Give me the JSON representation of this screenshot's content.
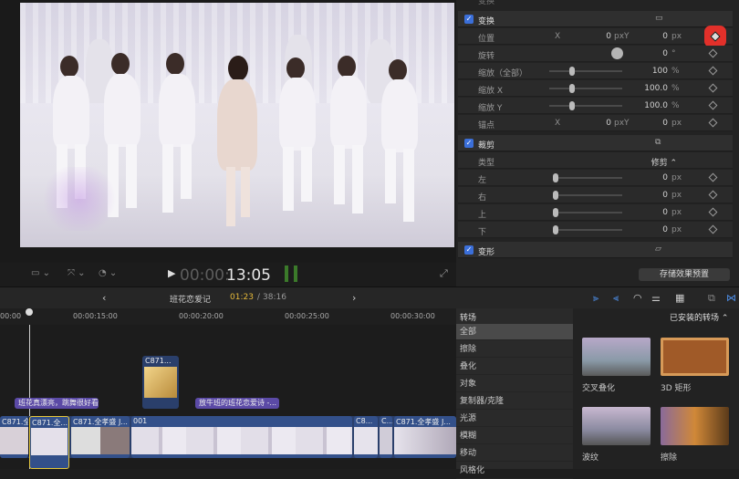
{
  "viewer": {
    "timecode_dim": "00:00:",
    "timecode": "13:05"
  },
  "inspector": {
    "top_label": "变换",
    "transform": {
      "title": "变换",
      "position": {
        "label": "位置",
        "x_label": "X",
        "x_value": "0",
        "x_unit": "px",
        "y_label": "Y",
        "y_value": "0",
        "y_unit": "px"
      },
      "rotation": {
        "label": "旋转",
        "value": "0",
        "unit": "°"
      },
      "scale_all": {
        "label": "缩放（全部）",
        "value": "100",
        "unit": "%"
      },
      "scale_x": {
        "label": "缩放 X",
        "value": "100.0",
        "unit": "%"
      },
      "scale_y": {
        "label": "缩放 Y",
        "value": "100.0",
        "unit": "%"
      },
      "anchor": {
        "label": "锚点",
        "x_label": "X",
        "x_value": "0",
        "x_unit": "px",
        "y_label": "Y",
        "y_value": "0",
        "y_unit": "px"
      }
    },
    "crop": {
      "title": "裁剪",
      "type": {
        "label": "类型",
        "value": "修剪 ⌃"
      },
      "left": {
        "label": "左",
        "value": "0",
        "unit": "px"
      },
      "right": {
        "label": "右",
        "value": "0",
        "unit": "px"
      },
      "top": {
        "label": "上",
        "value": "0",
        "unit": "px"
      },
      "bottom": {
        "label": "下",
        "value": "0",
        "unit": "px"
      }
    },
    "distort": {
      "title": "变形"
    },
    "save_preset": "存储效果预置"
  },
  "timeline_bar": {
    "project": "班花恋爱记",
    "current": "01:23",
    "separator": " / ",
    "duration": "38:16"
  },
  "ruler": [
    "00:00",
    "00:00:15:00",
    "00:00:20:00",
    "00:00:25:00",
    "00:00:30:00"
  ],
  "titles": [
    "班花真漂亮，跳舞很好看...",
    "放牛班的班花恋爱诗 -..."
  ],
  "clips": {
    "connected": "C871...",
    "primary": [
      "C871.全...",
      "C871.全...",
      "C871.全孝盛 J...",
      "001",
      "C8...",
      "C...",
      "C871.全孝盛 J..."
    ]
  },
  "transitions": {
    "header": "转场",
    "installed": "已安装的转场 ⌃",
    "categories": [
      "全部",
      "擦除",
      "叠化",
      "对象",
      "复制器/克隆",
      "光源",
      "模糊",
      "移动",
      "风格化"
    ],
    "items": [
      "交叉叠化",
      "3D 矩形",
      "波纹",
      "擦除"
    ]
  }
}
